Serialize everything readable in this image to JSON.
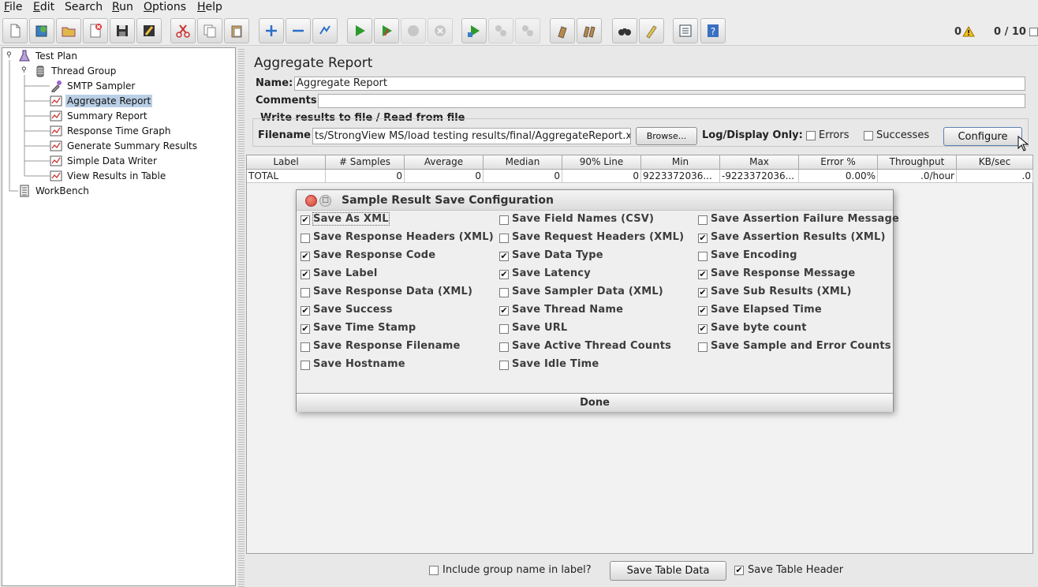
{
  "menu": [
    {
      "label": "File",
      "u": "F",
      "rest": "ile"
    },
    {
      "label": "Edit",
      "u": "E",
      "rest": "dit"
    },
    {
      "label": "Search",
      "u": "",
      "rest": "Search"
    },
    {
      "label": "Run",
      "u": "R",
      "rest": "un"
    },
    {
      "label": "Options",
      "u": "O",
      "rest": "ptions"
    },
    {
      "label": "Help",
      "u": "H",
      "rest": "elp"
    }
  ],
  "toolbar": {
    "warnings_count": "0",
    "thread_count": "0 / 10"
  },
  "tree": {
    "test_plan": "Test Plan",
    "thread_group": "Thread Group",
    "items": [
      "SMTP Sampler",
      "Aggregate Report",
      "Summary Report",
      "Response Time Graph",
      "Generate Summary Results",
      "Simple Data Writer",
      "View Results in Table"
    ],
    "workbench": "WorkBench",
    "selected": "Aggregate Report"
  },
  "panel": {
    "title": "Aggregate Report",
    "name_label": "Name:",
    "name_value": "Aggregate Report",
    "comments_label": "Comments:",
    "comments_value": "",
    "file_legend": "Write results to file / Read from file",
    "filename_label": "Filename",
    "filename_value": "ts/StrongView MS/load testing results/final/AggregateReport.xml",
    "browse_label": "Browse...",
    "log_display_label": "Log/Display Only:",
    "errors_label": "Errors",
    "successes_label": "Successes",
    "configure_label": "Configure"
  },
  "table": {
    "headers": [
      "Label",
      "# Samples",
      "Average",
      "Median",
      "90% Line",
      "Min",
      "Max",
      "Error %",
      "Throughput",
      "KB/sec"
    ],
    "row": [
      "TOTAL",
      "0",
      "0",
      "0",
      "0",
      "9223372036...",
      "-9223372036...",
      "0.00%",
      ".0/hour",
      ".0"
    ]
  },
  "bottom": {
    "include_group_label": "Include group name in label?",
    "save_table_data": "Save Table Data",
    "save_table_header": "Save Table Header"
  },
  "dialog": {
    "title": "Sample Result Save Configuration",
    "done_label": "Done",
    "options": [
      [
        {
          "label": "Save As XML",
          "checked": true
        },
        {
          "label": "Save Response Headers (XML)",
          "checked": false
        },
        {
          "label": "Save Response Code",
          "checked": true
        },
        {
          "label": "Save Label",
          "checked": true
        },
        {
          "label": "Save Response Data (XML)",
          "checked": false
        },
        {
          "label": "Save Success",
          "checked": true
        },
        {
          "label": "Save Time Stamp",
          "checked": true
        },
        {
          "label": "Save Response Filename",
          "checked": false
        },
        {
          "label": "Save Hostname",
          "checked": false
        }
      ],
      [
        {
          "label": "Save Field Names (CSV)",
          "checked": false
        },
        {
          "label": "Save Request Headers (XML)",
          "checked": false
        },
        {
          "label": "Save Data Type",
          "checked": true
        },
        {
          "label": "Save Latency",
          "checked": true
        },
        {
          "label": "Save Sampler Data (XML)",
          "checked": false
        },
        {
          "label": "Save Thread Name",
          "checked": true
        },
        {
          "label": "Save URL",
          "checked": false
        },
        {
          "label": "Save Active Thread Counts",
          "checked": false
        },
        {
          "label": "Save Idle Time",
          "checked": false
        }
      ],
      [
        {
          "label": "Save Assertion Failure Message",
          "checked": false
        },
        {
          "label": "Save Assertion Results (XML)",
          "checked": true
        },
        {
          "label": "Save Encoding",
          "checked": false
        },
        {
          "label": "Save Response Message",
          "checked": true
        },
        {
          "label": "Save Sub Results (XML)",
          "checked": true
        },
        {
          "label": "Save Elapsed Time",
          "checked": true
        },
        {
          "label": "Save byte count",
          "checked": true
        },
        {
          "label": "Save Sample and Error Counts",
          "checked": false
        }
      ]
    ]
  },
  "checks": {
    "errors": false,
    "successes": false,
    "include_group": false,
    "save_table_header": true
  }
}
